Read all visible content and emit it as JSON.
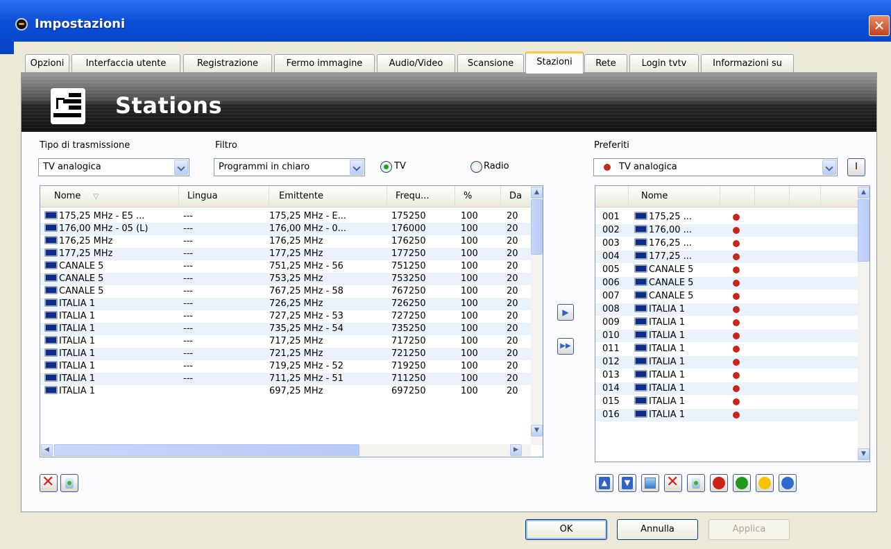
{
  "window": {
    "title": "Impostazioni",
    "close_glyph": "✕"
  },
  "tabs": [
    {
      "label": "Opzioni"
    },
    {
      "label": "Interfaccia utente"
    },
    {
      "label": "Registrazione"
    },
    {
      "label": "Fermo immagine"
    },
    {
      "label": "Audio/Video"
    },
    {
      "label": "Scansione"
    },
    {
      "label": "Stazioni",
      "active": true
    },
    {
      "label": "Rete"
    },
    {
      "label": "Login tvtv"
    },
    {
      "label": "Informazioni su"
    }
  ],
  "banner": {
    "title": "Stations",
    "icon": "stations-icon"
  },
  "left": {
    "tipo_label": "Tipo di trasmissione",
    "tipo_value": "TV analogica",
    "filtro_label": "Filtro",
    "filtro_value": "Programmi in chiaro",
    "radio_tv": "TV",
    "radio_radio": "Radio",
    "radio_selected": "TV",
    "columns": [
      "Nome",
      "Lingua",
      "Emittente",
      "Frequ...",
      "%",
      "Da"
    ],
    "rows": [
      [
        "175,25 MHz - E5 ...",
        "---",
        "175,25 MHz - E...",
        "175250",
        "100",
        "20"
      ],
      [
        "176,00 MHz - 05 (L)",
        "---",
        "176,00 MHz - 0...",
        "176000",
        "100",
        "20"
      ],
      [
        "176,25 MHz",
        "---",
        "176,25 MHz",
        "176250",
        "100",
        "20"
      ],
      [
        "177,25 MHz",
        "---",
        "177,25 MHz",
        "177250",
        "100",
        "20"
      ],
      [
        "CANALE 5",
        "---",
        "751,25 MHz - 56",
        "751250",
        "100",
        "20"
      ],
      [
        "CANALE 5",
        "---",
        "753,25 MHz",
        "753250",
        "100",
        "20"
      ],
      [
        "CANALE 5",
        "---",
        "767,25 MHz - 58",
        "767250",
        "100",
        "20"
      ],
      [
        "ITALIA 1",
        "---",
        "726,25 MHz",
        "726250",
        "100",
        "20"
      ],
      [
        "ITALIA 1",
        "---",
        "727,25 MHz - 53",
        "727250",
        "100",
        "20"
      ],
      [
        "ITALIA 1",
        "---",
        "735,25 MHz - 54",
        "735250",
        "100",
        "20"
      ],
      [
        "ITALIA 1",
        "---",
        "717,25 MHz",
        "717250",
        "100",
        "20"
      ],
      [
        "ITALIA 1",
        "---",
        "721,25 MHz",
        "721250",
        "100",
        "20"
      ],
      [
        "ITALIA 1",
        "---",
        "719,25 MHz - 52",
        "719250",
        "100",
        "20"
      ],
      [
        "ITALIA 1",
        "---",
        "711,25 MHz - 51",
        "711250",
        "100",
        "20"
      ],
      [
        "ITALIA 1",
        "",
        "697,25 MHz",
        "697250",
        "100",
        "20"
      ]
    ]
  },
  "right": {
    "preferiti_label": "Preferiti",
    "preferiti_value": "TV analogica",
    "edit_glyph": "I",
    "columns": [
      "Nome"
    ],
    "rows": [
      [
        "001",
        "175,25 ..."
      ],
      [
        "002",
        "176,00 ..."
      ],
      [
        "003",
        "176,25 ..."
      ],
      [
        "004",
        "177,25 ..."
      ],
      [
        "005",
        "CANALE 5"
      ],
      [
        "006",
        "CANALE 5"
      ],
      [
        "007",
        "CANALE 5"
      ],
      [
        "008",
        "ITALIA 1"
      ],
      [
        "009",
        "ITALIA 1"
      ],
      [
        "010",
        "ITALIA 1"
      ],
      [
        "011",
        "ITALIA 1"
      ],
      [
        "012",
        "ITALIA 1"
      ],
      [
        "013",
        "ITALIA 1"
      ],
      [
        "014",
        "ITALIA 1"
      ],
      [
        "015",
        "ITALIA 1"
      ],
      [
        "016",
        "ITALIA 1"
      ]
    ],
    "dot_color": "#c8261c"
  },
  "move": {
    "add_glyph": "▶",
    "add_all_glyph": "▶▶"
  },
  "toolbar_colors": {
    "red": "#d0201a",
    "green": "#1f9a1f",
    "yellow": "#f6c400",
    "blue": "#2f6ad0"
  },
  "buttons": {
    "ok": "OK",
    "cancel": "Annulla",
    "apply": "Applica"
  }
}
